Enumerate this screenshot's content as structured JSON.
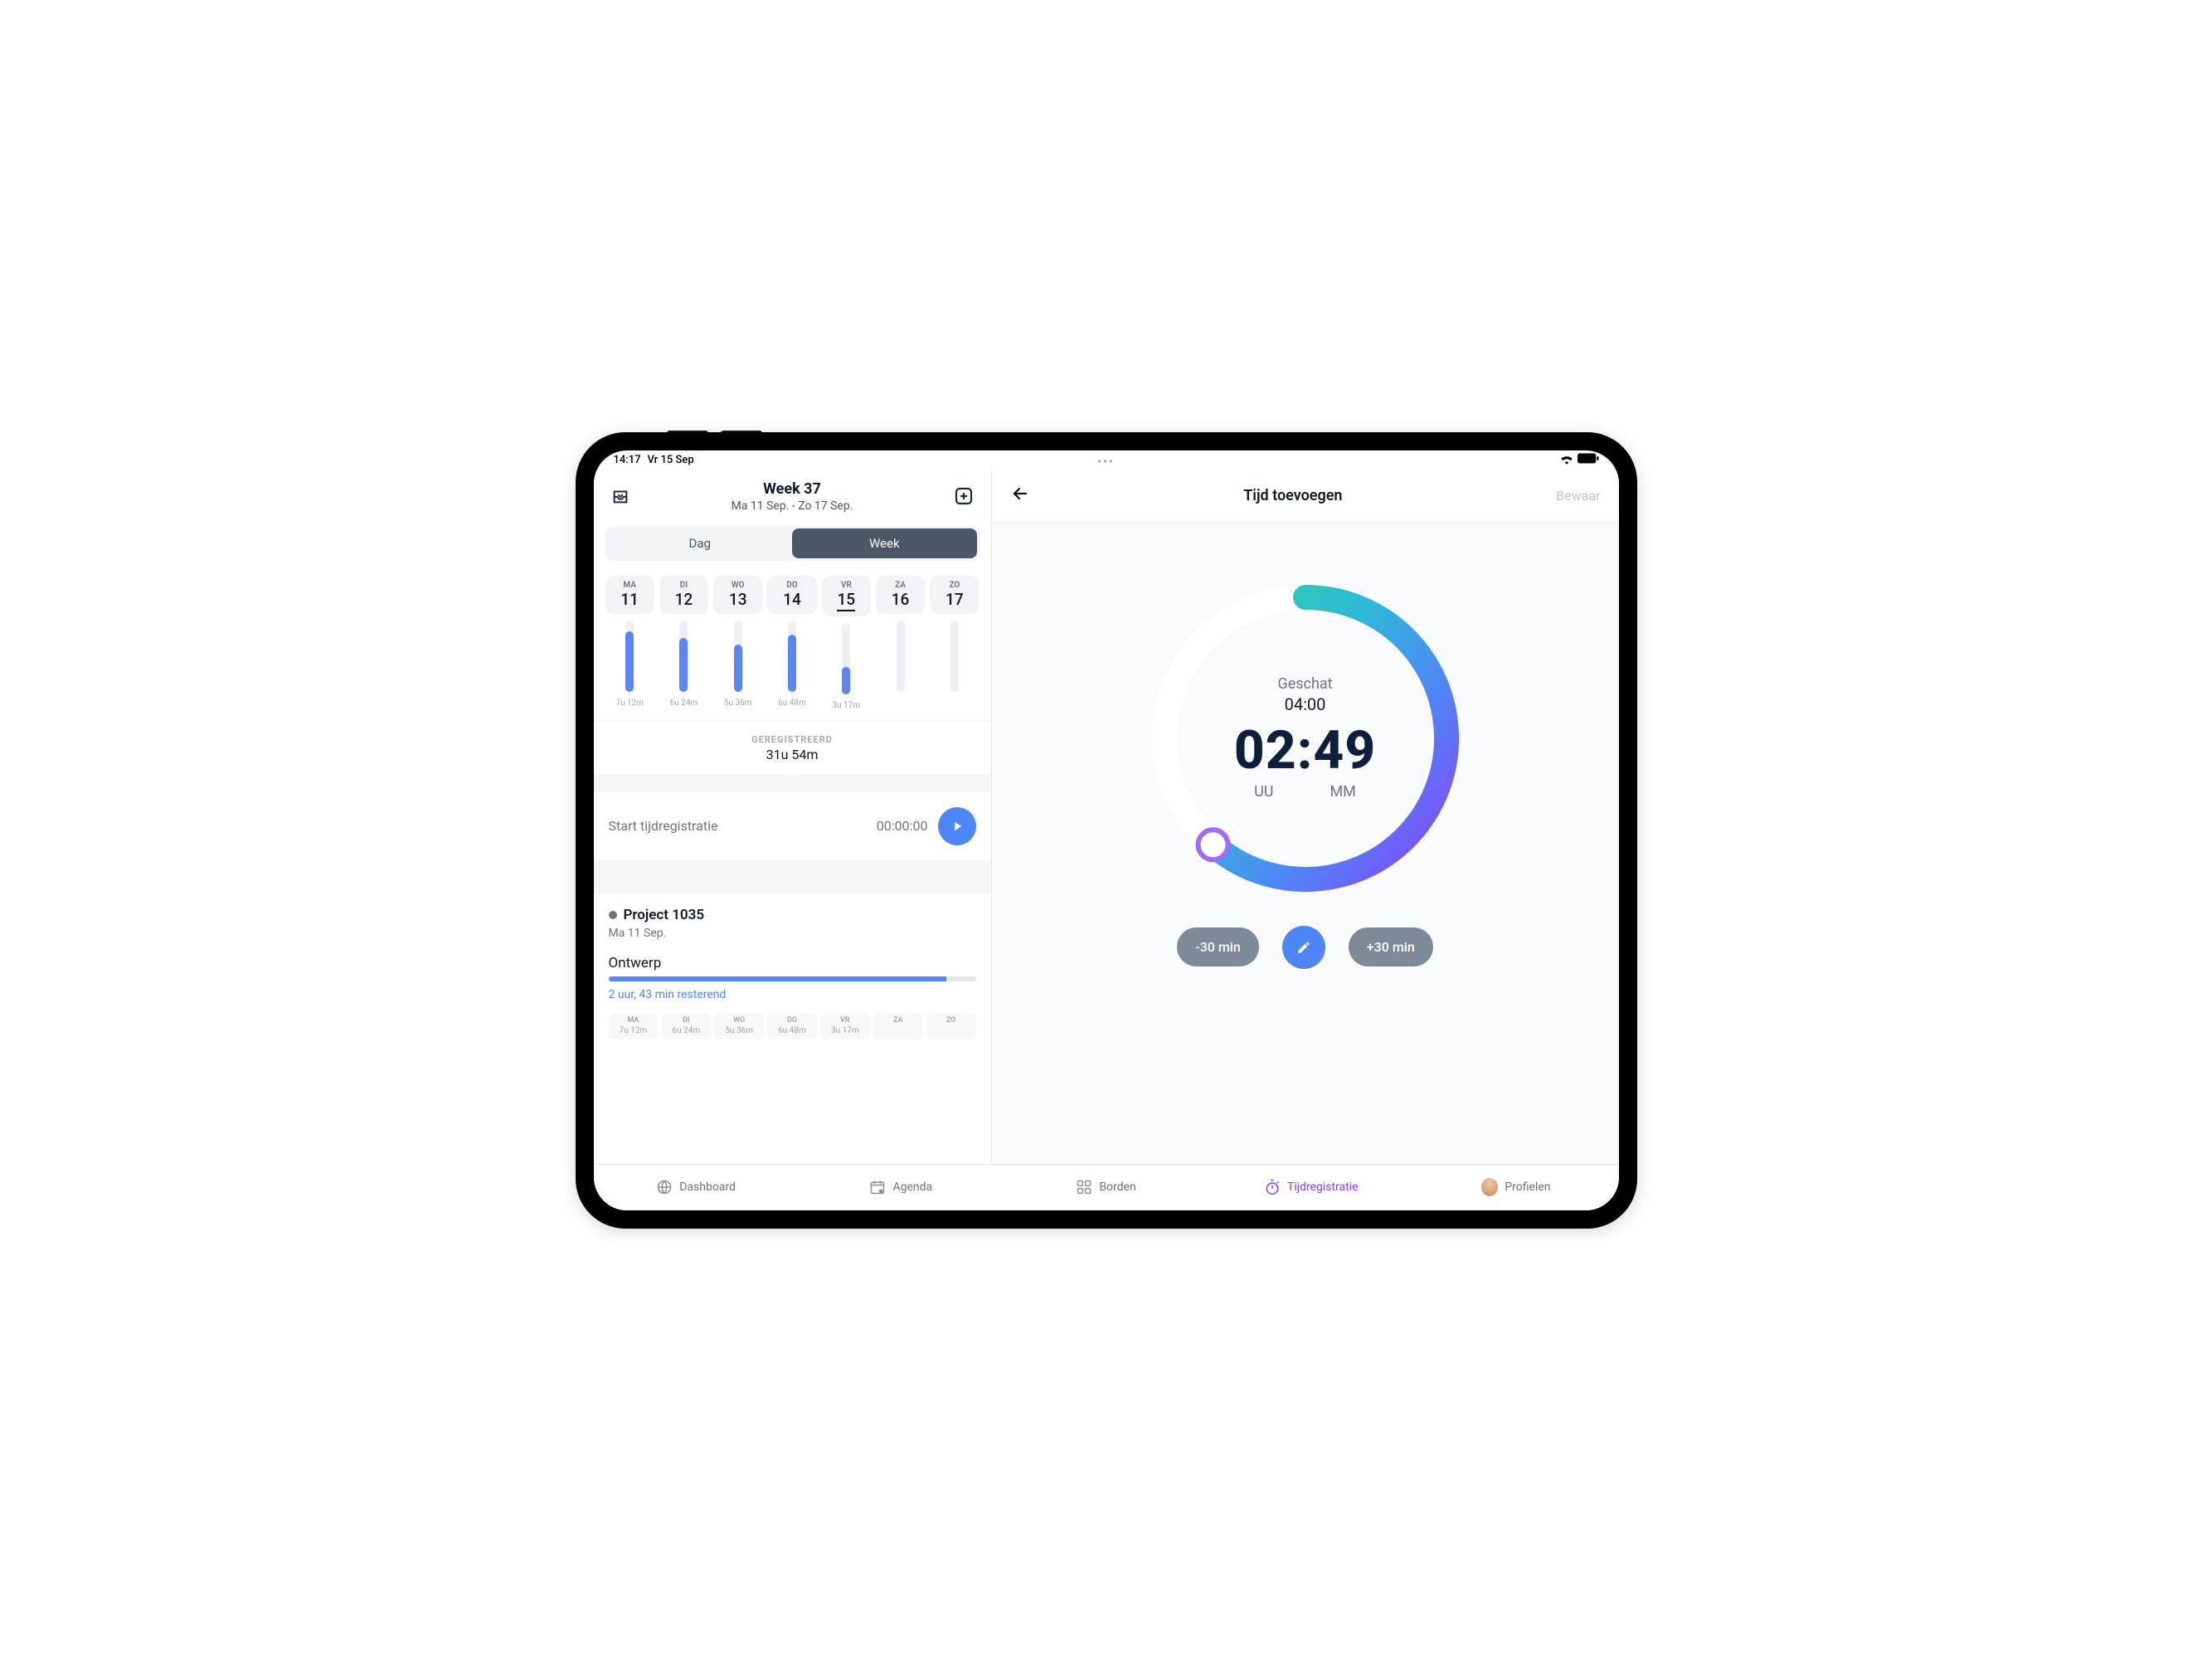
{
  "status_bar": {
    "time": "14:17",
    "date": "Vr 15 Sep"
  },
  "left": {
    "week_title": "Week 37",
    "week_range": "Ma 11 Sep. - Zo 17 Sep.",
    "segmented": {
      "day": "Dag",
      "week": "Week"
    },
    "days": [
      {
        "short": "MA",
        "num": "11",
        "dur": "7u 12m",
        "fill": 84,
        "selected": false
      },
      {
        "short": "DI",
        "num": "12",
        "dur": "6u 24m",
        "fill": 75,
        "selected": false
      },
      {
        "short": "WO",
        "num": "13",
        "dur": "5u 36m",
        "fill": 66,
        "selected": false
      },
      {
        "short": "DO",
        "num": "14",
        "dur": "6u 48m",
        "fill": 80,
        "selected": false
      },
      {
        "short": "VR",
        "num": "15",
        "dur": "3u 17m",
        "fill": 38,
        "selected": true
      },
      {
        "short": "ZA",
        "num": "16",
        "dur": "",
        "fill": 0,
        "selected": false
      },
      {
        "short": "ZO",
        "num": "17",
        "dur": "",
        "fill": 0,
        "selected": false
      }
    ],
    "registered_label": "GEREGISTREERD",
    "registered_value": "31u 54m",
    "start_label": "Start tijdregistratie",
    "start_time": "00:00:00",
    "project": {
      "name": "Project 1035",
      "date": "Ma 11 Sep.",
      "task": "Ontwerp",
      "progress_pct": 92,
      "remaining": "2 uur, 43 min resterend",
      "mini_days": [
        {
          "short": "MA",
          "val": "7u 12m"
        },
        {
          "short": "DI",
          "val": "6u 24m"
        },
        {
          "short": "WO",
          "val": "5u 36m"
        },
        {
          "short": "DO",
          "val": "6u 48m"
        },
        {
          "short": "VR",
          "val": "3u 17m"
        },
        {
          "short": "ZA",
          "val": ""
        },
        {
          "short": "ZO",
          "val": ""
        }
      ]
    }
  },
  "right": {
    "title": "Tijd toevoegen",
    "save": "Bewaar",
    "estimated_label": "Geschat",
    "estimated_value": "04:00",
    "time_value": "02:49",
    "unit_hours": "UU",
    "unit_minutes": "MM",
    "minus": "-30 min",
    "plus": "+30 min"
  },
  "nav": {
    "dashboard": "Dashboard",
    "agenda": "Agenda",
    "boards": "Borden",
    "time": "Tijdregistratie",
    "profiles": "Profielen"
  }
}
